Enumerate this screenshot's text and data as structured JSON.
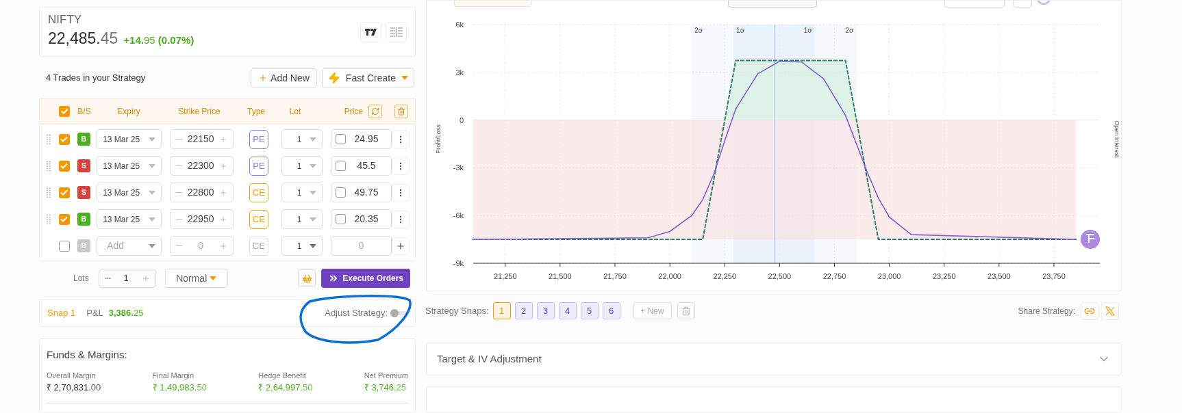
{
  "quote": {
    "symbol": "NIFTY",
    "price_main": "22,485.",
    "price_decimal": "45",
    "change_main": "+14.",
    "change_decimal": "95",
    "change_pct": "(0.07%)"
  },
  "trades_header": {
    "title": "4 Trades in your Strategy",
    "add_button": "Add New",
    "fast_button": "Fast Create"
  },
  "table": {
    "all_checked": true,
    "columns": [
      "B/S",
      "Expiry",
      "Strike Price",
      "Type",
      "Lot",
      "Price"
    ],
    "rows": [
      {
        "kind": "trade",
        "checked": true,
        "side": "B",
        "expiry": "13 Mar 25",
        "strike": "22150",
        "type": "PE",
        "lot": "1",
        "price": "24.95",
        "price_checked": false
      },
      {
        "kind": "trade",
        "checked": true,
        "side": "S",
        "expiry": "13 Mar 25",
        "strike": "22300",
        "type": "PE",
        "lot": "1",
        "price": "45.5",
        "price_checked": false
      },
      {
        "kind": "trade",
        "checked": true,
        "side": "S",
        "expiry": "13 Mar 25",
        "strike": "22800",
        "type": "CE",
        "lot": "1",
        "price": "49.75",
        "price_checked": false
      },
      {
        "kind": "trade",
        "checked": true,
        "side": "B",
        "expiry": "13 Mar 25",
        "strike": "22950",
        "type": "CE",
        "lot": "1",
        "price": "20.35",
        "price_checked": false
      },
      {
        "kind": "new",
        "checked": false,
        "side": "B",
        "expiry_placeholder": "Add",
        "strike": "0",
        "type": "CE",
        "lot": "1",
        "price_placeholder": "0"
      }
    ]
  },
  "lots": {
    "label": "Lots",
    "value": "1"
  },
  "order_type": "Normal",
  "execute_button": "Execute Orders",
  "snap": {
    "label": "Snap 1",
    "pnl_label": "P&L",
    "pnl_main": "3,386.",
    "pnl_decimal": "25",
    "adjust_label": "Adjust Strategy:",
    "adjust_on": false
  },
  "funds": {
    "title": "Funds & Margins:",
    "items": [
      {
        "label": "Overall Margin",
        "main": "₹ 2,70,831.",
        "decimal": "00",
        "kind": "neutral"
      },
      {
        "label": "Final Margin",
        "main": "₹ 1,49,983.",
        "decimal": "50",
        "kind": "positive"
      },
      {
        "label": "Hedge Benefit",
        "main": "₹ 2,64,997.",
        "decimal": "50",
        "kind": "positive"
      },
      {
        "label": "Net Premium",
        "main": "₹ 3,746.",
        "decimal": "25",
        "kind": "positive"
      }
    ]
  },
  "chart_data": {
    "type": "line",
    "ylabel": "Profit/Loss",
    "y2label": "Open Interest",
    "x": [
      21104,
      21900,
      22000,
      22100,
      22150,
      22200,
      22250,
      22300,
      22400,
      22500,
      22600,
      22700,
      22800,
      22850,
      22900,
      22950,
      23000,
      23100,
      23850
    ],
    "xlim": [
      21104,
      23959
    ],
    "ylim": [
      -9000,
      6000
    ],
    "grid": true,
    "xticks": [
      {
        "value": 21250,
        "label": "21,250"
      },
      {
        "value": 21500,
        "label": "21,500"
      },
      {
        "value": 21750,
        "label": "21,750"
      },
      {
        "value": 22000,
        "label": "22,000"
      },
      {
        "value": 22250,
        "label": "22,250"
      },
      {
        "value": 22500,
        "label": "22,500"
      },
      {
        "value": 22750,
        "label": "22,750"
      },
      {
        "value": 23000,
        "label": "23,000"
      },
      {
        "value": 23250,
        "label": "23,250"
      },
      {
        "value": 23500,
        "label": "23,500"
      },
      {
        "value": 23750,
        "label": "23,750"
      }
    ],
    "yticks": [
      {
        "value": 6000,
        "label": "6k"
      },
      {
        "value": 3000,
        "label": "3k"
      },
      {
        "value": 0,
        "label": "0"
      },
      {
        "value": -3000,
        "label": "-3k"
      },
      {
        "value": -6000,
        "label": "-6k"
      },
      {
        "value": -9000,
        "label": "-9k"
      }
    ],
    "series": [
      {
        "color": "#2e7d6b",
        "line_style": "dashed",
        "values": [
          -7500,
          -7500,
          -7500,
          -7500,
          -7500,
          -3750,
          0,
          3750,
          3750,
          3750,
          3750,
          3750,
          3750,
          0,
          -3750,
          -7500,
          -7500,
          -7500,
          -7500
        ]
      },
      {
        "color": "#7e5fd0",
        "line_style": "solid",
        "values": [
          -7500,
          -7400,
          -7000,
          -6000,
          -5000,
          -3400,
          -1300,
          700,
          2900,
          3700,
          3650,
          2600,
          300,
          -1500,
          -3300,
          -4900,
          -6100,
          -7200,
          -7500
        ]
      }
    ],
    "bands": [
      {
        "axis": "x",
        "from": 22100,
        "to": 22850,
        "label": "2σ",
        "color": "#f5f8fd"
      },
      {
        "axis": "x",
        "from": 22290,
        "to": 22660,
        "label": "1σ",
        "color": "#eaf2fc"
      }
    ],
    "ref_lines": [
      {
        "axis": "x",
        "value": 22476,
        "color": "#a9c3f5"
      }
    ]
  },
  "snaps": {
    "label": "Strategy Snaps:",
    "items": [
      {
        "label": "1",
        "selected": true
      },
      {
        "label": "2",
        "selected": false
      },
      {
        "label": "3",
        "selected": false
      },
      {
        "label": "4",
        "selected": false
      },
      {
        "label": "5",
        "selected": false
      },
      {
        "label": "6",
        "selected": false
      }
    ],
    "new_button": "+ New"
  },
  "share": {
    "label": "Share Strategy:"
  },
  "sections": [
    {
      "title": "Target & IV Adjustment",
      "expanded": false
    }
  ]
}
